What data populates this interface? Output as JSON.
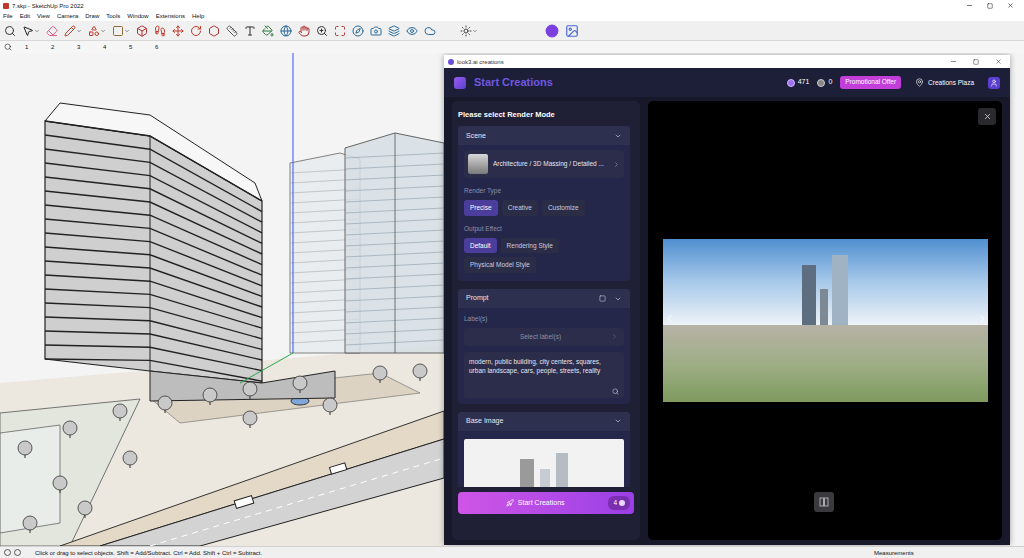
{
  "window": {
    "title": "7.skp - SketchUp Pro 2022"
  },
  "menu": [
    "File",
    "Edit",
    "View",
    "Camera",
    "Draw",
    "Tools",
    "Window",
    "Extensions",
    "Help"
  ],
  "scene_tabs": [
    "1",
    "2",
    "3",
    "4",
    "5",
    "6"
  ],
  "status_bar": {
    "hint": "Click or drag to select objects. Shift = Add/Subtract. Ctrl = Add. Shift + Ctrl = Subtract.",
    "measurements": "Measurements"
  },
  "plugin": {
    "title": "look3.ai creations",
    "heading": "Start Creations",
    "credits": "471",
    "other_credits": "0",
    "promo": "Promotional Offer",
    "plaza": "Creations Plaza",
    "render_mode_title": "Please select Render Mode",
    "scene": {
      "title": "Scene",
      "expanded": true,
      "style": "Architecture / 3D Massing / Detailed ...",
      "render_type_label": "Render Type",
      "render_types": [
        {
          "label": "Precise",
          "selected": true
        },
        {
          "label": "Creative",
          "selected": false
        },
        {
          "label": "Customize",
          "selected": false
        }
      ],
      "output_effect_label": "Output Effect",
      "output_effects": [
        {
          "label": "Default",
          "selected": true
        },
        {
          "label": "Rendering Style",
          "selected": false
        },
        {
          "label": "Physical Model Style",
          "selected": false
        }
      ]
    },
    "prompt": {
      "title": "Prompt",
      "expanded": true,
      "labels_label": "Label(s)",
      "labels_placeholder": "Select label(s)",
      "text": "modern, public building, city centers, squares, urban landscape, cars, people, streets, reality"
    },
    "base_image": {
      "title": "Base Image",
      "expanded": true
    },
    "start_button": {
      "label": "Start Creations",
      "cost": "4"
    }
  }
}
